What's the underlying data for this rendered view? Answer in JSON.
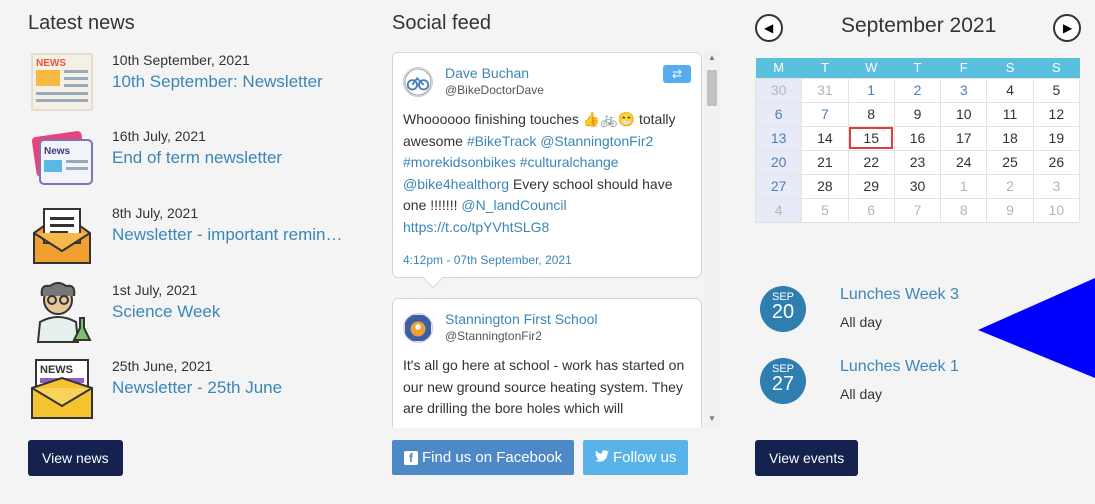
{
  "news": {
    "heading": "Latest news",
    "items": [
      {
        "date": "10th September, 2021",
        "title": "10th September: Newsletter",
        "icon": "newspaper-icon"
      },
      {
        "date": "16th July, 2021",
        "title": "End of term newsletter",
        "icon": "news-tablet-icon"
      },
      {
        "date": "8th July, 2021",
        "title": "Newsletter - important remin…",
        "icon": "envelope-letter-icon"
      },
      {
        "date": "1st July, 2021",
        "title": "Science Week",
        "icon": "scientist-icon"
      },
      {
        "date": "25th June, 2021",
        "title": "Newsletter - 25th June",
        "icon": "news-envelope-icon"
      }
    ],
    "view_button": "View news",
    "thumb_badges": {
      "news1": "NEWS",
      "news2": "News",
      "news5": "NEWS"
    }
  },
  "social": {
    "heading": "Social feed",
    "posts": [
      {
        "name": "Dave Buchan",
        "handle": "@BikeDoctorDave",
        "text_parts": [
          "Whoooooo finishing touches 👍🚲😁 totally awesome ",
          "#BikeTrack",
          " ",
          "@StanningtonFir2",
          " ",
          "#morekidsonbikes",
          " ",
          "#culturalchange",
          " ",
          "@bike4healthorg",
          " Every school should have one !!!!!!! ",
          "@N_landCouncil",
          " ",
          "https://t.co/tpYVhtSLG8"
        ],
        "time": "4:12pm - 07th September, 2021"
      },
      {
        "name": "Stannington First School",
        "handle": "@StanningtonFir2",
        "text": "It's all go here at school - work has started on our new ground source heating system. They are drilling the bore holes which will"
      }
    ],
    "facebook_button": "Find us on Facebook",
    "twitter_button": "Follow us"
  },
  "calendar": {
    "title": "September 2021",
    "weekdays": [
      "M",
      "T",
      "W",
      "T",
      "F",
      "S",
      "S"
    ],
    "weeks": [
      [
        {
          "d": "30",
          "s": "dim"
        },
        {
          "d": "31",
          "s": "dim"
        },
        {
          "d": "1",
          "s": "cur"
        },
        {
          "d": "2",
          "s": "cur"
        },
        {
          "d": "3",
          "s": "cur"
        },
        {
          "d": "4",
          "s": ""
        },
        {
          "d": "5",
          "s": ""
        }
      ],
      [
        {
          "d": "6",
          "s": "cur"
        },
        {
          "d": "7",
          "s": "cur"
        },
        {
          "d": "8",
          "s": ""
        },
        {
          "d": "9",
          "s": ""
        },
        {
          "d": "10",
          "s": ""
        },
        {
          "d": "11",
          "s": ""
        },
        {
          "d": "12",
          "s": ""
        }
      ],
      [
        {
          "d": "13",
          "s": "cur"
        },
        {
          "d": "14",
          "s": ""
        },
        {
          "d": "15",
          "s": "today"
        },
        {
          "d": "16",
          "s": ""
        },
        {
          "d": "17",
          "s": ""
        },
        {
          "d": "18",
          "s": ""
        },
        {
          "d": "19",
          "s": ""
        }
      ],
      [
        {
          "d": "20",
          "s": "cur"
        },
        {
          "d": "21",
          "s": ""
        },
        {
          "d": "22",
          "s": ""
        },
        {
          "d": "23",
          "s": ""
        },
        {
          "d": "24",
          "s": ""
        },
        {
          "d": "25",
          "s": ""
        },
        {
          "d": "26",
          "s": ""
        }
      ],
      [
        {
          "d": "27",
          "s": "cur"
        },
        {
          "d": "28",
          "s": ""
        },
        {
          "d": "29",
          "s": ""
        },
        {
          "d": "30",
          "s": ""
        },
        {
          "d": "1",
          "s": "dim"
        },
        {
          "d": "2",
          "s": "dim"
        },
        {
          "d": "3",
          "s": "dim"
        }
      ],
      [
        {
          "d": "4",
          "s": "dim"
        },
        {
          "d": "5",
          "s": "dim"
        },
        {
          "d": "6",
          "s": "dim"
        },
        {
          "d": "7",
          "s": "dim"
        },
        {
          "d": "8",
          "s": "dim"
        },
        {
          "d": "9",
          "s": "dim"
        },
        {
          "d": "10",
          "s": "dim"
        }
      ]
    ],
    "events": [
      {
        "month": "SEP",
        "day": "20",
        "title": "Lunches Week 3",
        "sub": "All day"
      },
      {
        "month": "SEP",
        "day": "27",
        "title": "Lunches Week 1",
        "sub": "All day"
      }
    ],
    "view_button": "View events"
  },
  "colors": {
    "accent": "#3a86b8",
    "dark_button": "#15214e",
    "calendar_header": "#5bc0de",
    "overlay_arrow": "#0000ff"
  }
}
